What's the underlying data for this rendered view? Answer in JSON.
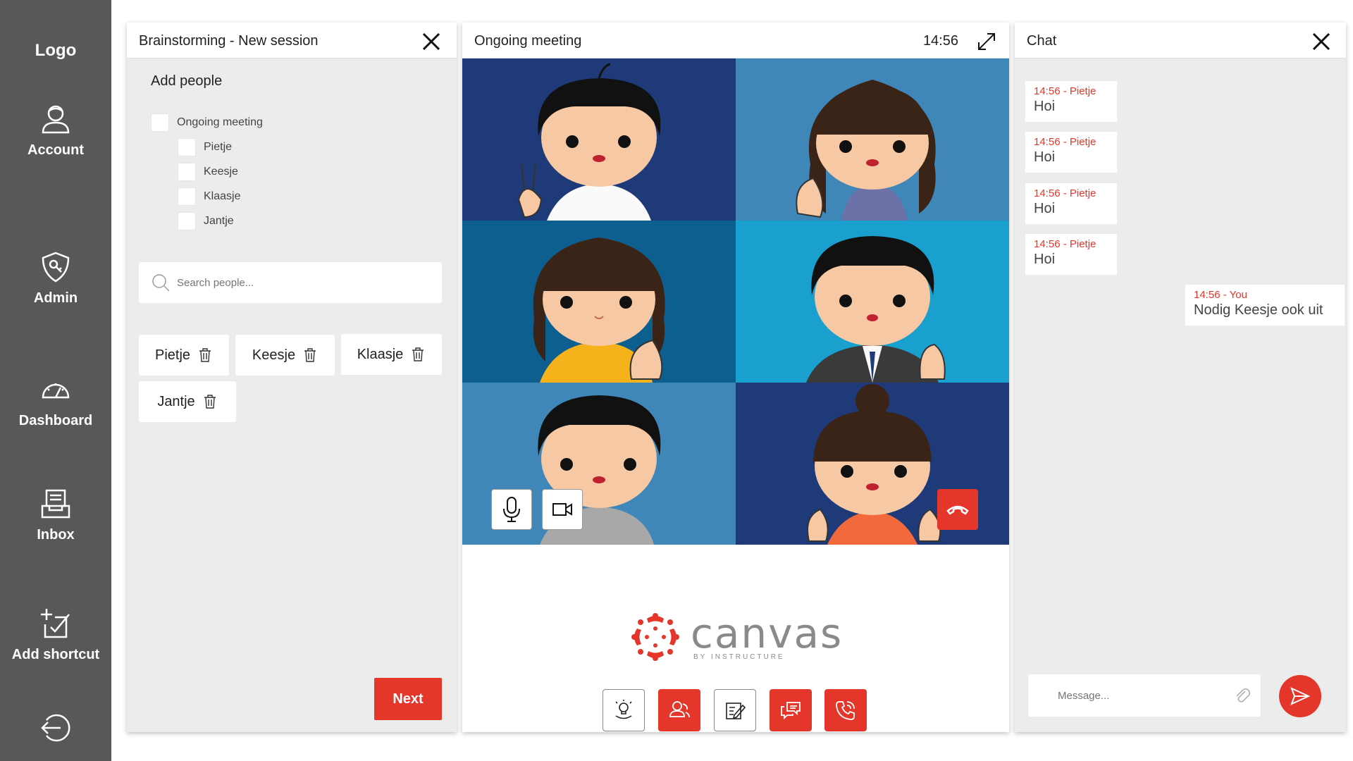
{
  "sidebar": {
    "logo": "Logo",
    "items": [
      {
        "label": "Account",
        "icon": "account-icon"
      },
      {
        "label": "Admin",
        "icon": "admin-shield-icon"
      },
      {
        "label": "Dashboard",
        "icon": "dashboard-gauge-icon"
      },
      {
        "label": "Inbox",
        "icon": "inbox-icon"
      },
      {
        "label": "Add shortcut",
        "icon": "add-shortcut-icon"
      }
    ],
    "logout_icon": "logout-icon"
  },
  "left_panel": {
    "title": "Brainstorming - New session",
    "add_people_label": "Add people",
    "group": "Ongoing meeting",
    "people": [
      "Pietje",
      "Keesje",
      "Klaasje",
      "Jantje"
    ],
    "search_placeholder": "Search people...",
    "chips": [
      "Pietje",
      "Keesje",
      "Klaasje",
      "Jantje"
    ],
    "next_label": "Next"
  },
  "meeting": {
    "title": "Ongoing meeting",
    "time": "14:56",
    "canvas_word": "canvas",
    "canvas_sub": "BY INSTRUCTURE",
    "tools": [
      "lightbulb-icon",
      "people-icon",
      "edit-note-icon",
      "chat-bubbles-icon",
      "phone-call-icon"
    ]
  },
  "chat": {
    "title": "Chat",
    "messages": [
      {
        "meta": "14:56 - Pietje",
        "text": "Hoi"
      },
      {
        "meta": "14:56 - Pietje",
        "text": "Hoi"
      },
      {
        "meta": "14:56 - Pietje",
        "text": "Hoi"
      },
      {
        "meta": "14:56 - Pietje",
        "text": "Hoi"
      },
      {
        "meta": "14:56 - You",
        "text": "Nodig Keesje ook uit"
      }
    ],
    "message_placeholder": "Message..."
  },
  "colors": {
    "accent": "#e5362b",
    "sidebar": "#585858",
    "panel": "#ececec"
  }
}
